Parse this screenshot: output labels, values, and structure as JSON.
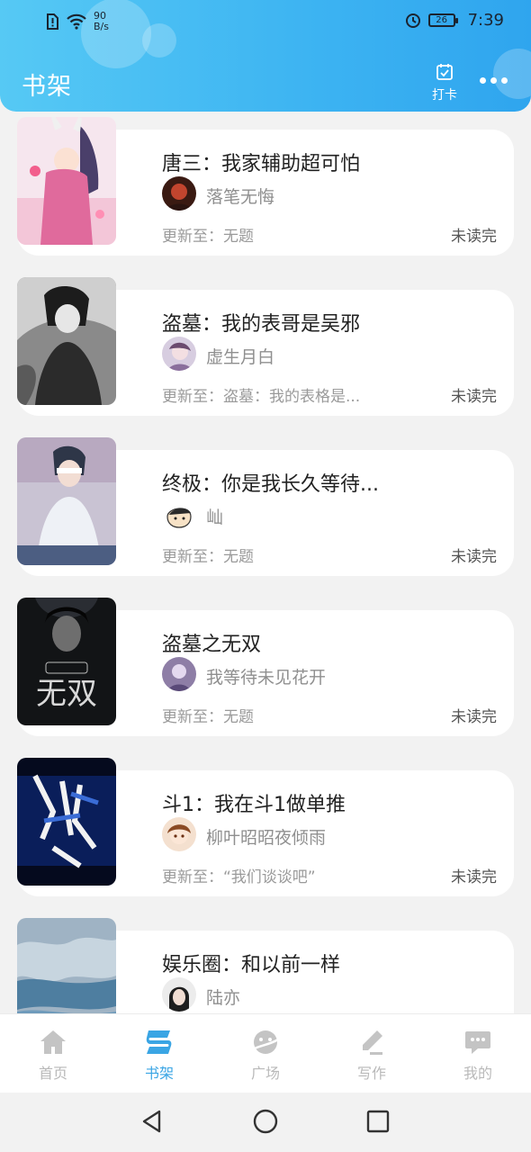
{
  "status_bar": {
    "net_speed_value": "90",
    "net_speed_unit": "B/s",
    "battery": "26",
    "time": "7:39"
  },
  "header": {
    "title": "书架",
    "checkin_label": "打卡"
  },
  "books": [
    {
      "title": "唐三：我家辅助超可怕",
      "author": "落笔无悔",
      "update": "更新至：无题",
      "status": "未读完"
    },
    {
      "title": "盗墓：我的表哥是吴邪",
      "author": "虚生月白",
      "update": "更新至：盗墓：我的表格是...",
      "status": "未读完"
    },
    {
      "title": "终极：你是我长久等待...",
      "author": "屾",
      "update": "更新至：无题",
      "status": "未读完"
    },
    {
      "title": "盗墓之无双",
      "author": "我等待未见花开",
      "update": "更新至：无题",
      "status": "未读完",
      "cover_text": "无双"
    },
    {
      "title": "斗1：我在斗1做单推",
      "author": "柳叶昭昭夜倾雨",
      "update": "更新至：“我们谈谈吧”",
      "status": "未读完"
    },
    {
      "title": "娱乐圈：和以前一样",
      "author": "陆亦",
      "update": "",
      "status": ""
    }
  ],
  "bottom_nav": [
    {
      "label": "首页",
      "icon": "home-icon"
    },
    {
      "label": "书架",
      "icon": "bookshelf-icon",
      "active": true
    },
    {
      "label": "广场",
      "icon": "plaza-icon"
    },
    {
      "label": "写作",
      "icon": "pen-icon"
    },
    {
      "label": "我的",
      "icon": "chat-bubble-icon"
    }
  ],
  "colors": {
    "header_start": "#56c9f4",
    "header_end": "#2fa5ee",
    "accent": "#3aa5e4",
    "inactive": "#b9b9b9"
  }
}
